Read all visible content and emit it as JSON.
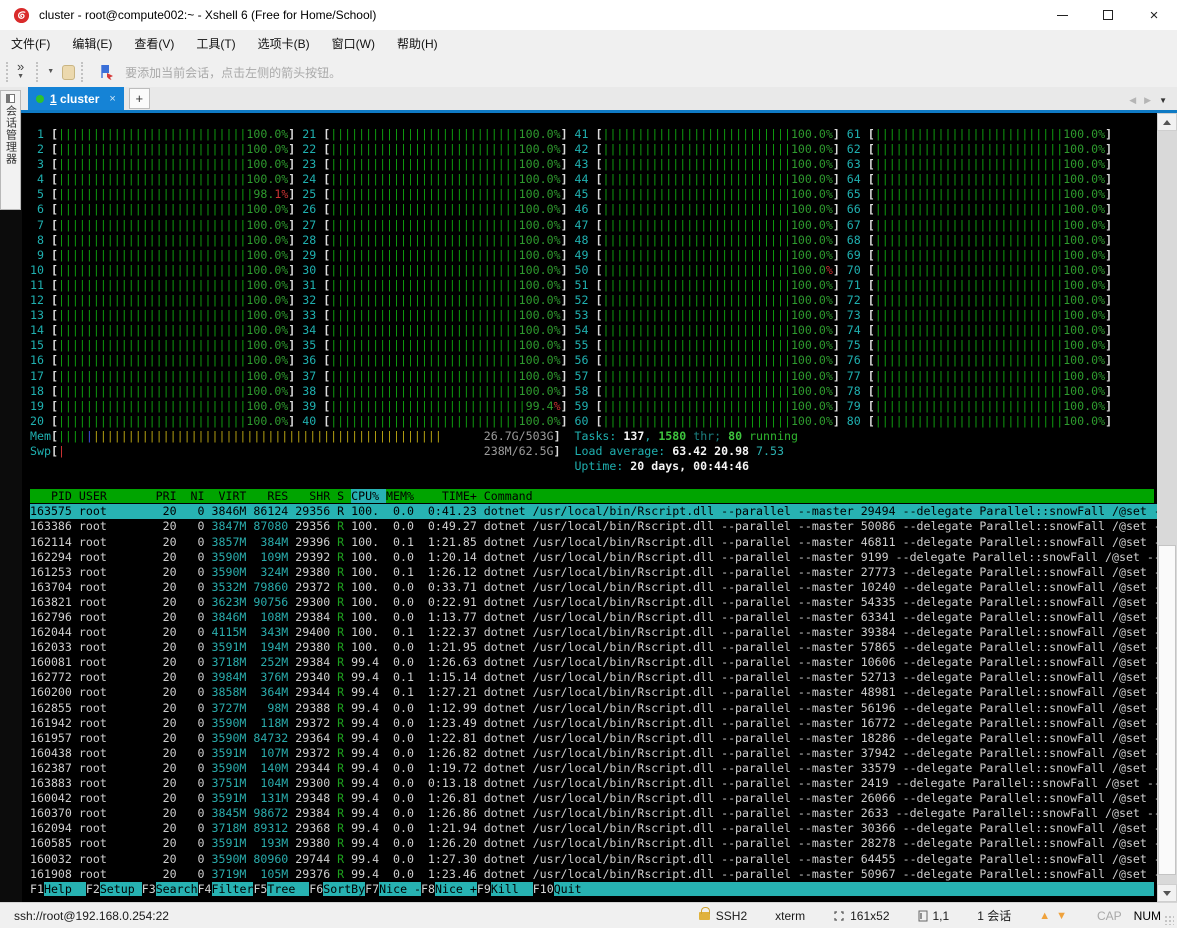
{
  "window": {
    "title": "cluster - root@compute002:~ - Xshell 6 (Free for Home/School)"
  },
  "menu": [
    "文件(F)",
    "编辑(E)",
    "查看(V)",
    "工具(T)",
    "选项卡(B)",
    "窗口(W)",
    "帮助(H)"
  ],
  "toolbar": {
    "chevron": "»",
    "hint": "要添加当前会话，点击左侧的箭头按钮。"
  },
  "side_tab": "会话管理器",
  "tabbar": {
    "tab_number": "1",
    "tab_name": "cluster",
    "close": "×",
    "new_tab": "+"
  },
  "colors": {
    "accent_blue": "#1583d6",
    "tab_underline": "#0f7ac4",
    "term_green": "#00a400",
    "term_cyan": "#27b2b2",
    "term_red": "#cc3333",
    "term_yellow": "#b3a011",
    "status_dot": "#2ec22e"
  },
  "terminal": {
    "cpu": {
      "count": 80,
      "default": [
        "100.0%",
        ""
      ],
      "overrides": {
        "5": [
          "98.",
          "1%"
        ],
        "39": [
          "99.4",
          "%"
        ],
        "50": [
          "100.0",
          "%"
        ]
      }
    },
    "mem": {
      "label": "Mem",
      "value": "26.7G/503G",
      "green": 4,
      "blue": 1,
      "yellow": 50
    },
    "swp": {
      "label": "Swp",
      "value": "238M/62.5G",
      "red": 1
    },
    "tasks": {
      "label": "Tasks: ",
      "count": "137",
      "threads": "1580",
      "thr_word": "thr",
      "running": "80",
      "running_word": "running"
    },
    "load": {
      "label": "Load average: ",
      "values": [
        "63.42",
        "20.98",
        "7.53"
      ]
    },
    "uptime": {
      "label": "Uptime: ",
      "value": "20 days, 00:44:46"
    },
    "header": [
      "PID",
      "USER",
      "PRI",
      "NI",
      "VIRT",
      "RES",
      "SHR",
      "S",
      "CPU%",
      "MEM%",
      "TIME+",
      "Command"
    ],
    "sort_column": "CPU%",
    "selected_pid": "163575",
    "rows": [
      [
        "163575",
        "root",
        "20",
        "0",
        "3846M",
        "86124",
        "29356",
        "R",
        "100.",
        "0.0",
        "0:41.23",
        "dotnet /usr/local/bin/Rscript.dll --parallel --master 29494 --delegate Parallel::snowFall /@set -"
      ],
      [
        "163386",
        "root",
        "20",
        "0",
        "3847M",
        "87080",
        "29356",
        "R",
        "100.",
        "0.0",
        "0:49.27",
        "dotnet /usr/local/bin/Rscript.dll --parallel --master 50086 --delegate Parallel::snowFall /@set -"
      ],
      [
        "162114",
        "root",
        "20",
        "0",
        "3857M",
        "384M",
        "29396",
        "R",
        "100.",
        "0.1",
        "1:21.85",
        "dotnet /usr/local/bin/Rscript.dll --parallel --master 46811 --delegate Parallel::snowFall /@set -"
      ],
      [
        "162294",
        "root",
        "20",
        "0",
        "3590M",
        "109M",
        "29392",
        "R",
        "100.",
        "0.0",
        "1:20.14",
        "dotnet /usr/local/bin/Rscript.dll --parallel --master 9199 --delegate Parallel::snowFall /@set --"
      ],
      [
        "161253",
        "root",
        "20",
        "0",
        "3590M",
        "324M",
        "29380",
        "R",
        "100.",
        "0.1",
        "1:26.12",
        "dotnet /usr/local/bin/Rscript.dll --parallel --master 27773 --delegate Parallel::snowFall /@set -"
      ],
      [
        "163704",
        "root",
        "20",
        "0",
        "3532M",
        "79860",
        "29372",
        "R",
        "100.",
        "0.0",
        "0:33.71",
        "dotnet /usr/local/bin/Rscript.dll --parallel --master 10240 --delegate Parallel::snowFall /@set -"
      ],
      [
        "163821",
        "root",
        "20",
        "0",
        "3623M",
        "90756",
        "29300",
        "R",
        "100.",
        "0.0",
        "0:22.91",
        "dotnet /usr/local/bin/Rscript.dll --parallel --master 54335 --delegate Parallel::snowFall /@set -"
      ],
      [
        "162796",
        "root",
        "20",
        "0",
        "3846M",
        "108M",
        "29384",
        "R",
        "100.",
        "0.0",
        "1:13.77",
        "dotnet /usr/local/bin/Rscript.dll --parallel --master 63341 --delegate Parallel::snowFall /@set -"
      ],
      [
        "162044",
        "root",
        "20",
        "0",
        "4115M",
        "343M",
        "29400",
        "R",
        "100.",
        "0.1",
        "1:22.37",
        "dotnet /usr/local/bin/Rscript.dll --parallel --master 39384 --delegate Parallel::snowFall /@set -"
      ],
      [
        "162033",
        "root",
        "20",
        "0",
        "3591M",
        "194M",
        "29380",
        "R",
        "100.",
        "0.0",
        "1:21.95",
        "dotnet /usr/local/bin/Rscript.dll --parallel --master 57865 --delegate Parallel::snowFall /@set -"
      ],
      [
        "160081",
        "root",
        "20",
        "0",
        "3718M",
        "252M",
        "29384",
        "R",
        "99.4",
        "0.0",
        "1:26.63",
        "dotnet /usr/local/bin/Rscript.dll --parallel --master 10606 --delegate Parallel::snowFall /@set -"
      ],
      [
        "162772",
        "root",
        "20",
        "0",
        "3984M",
        "376M",
        "29340",
        "R",
        "99.4",
        "0.1",
        "1:15.14",
        "dotnet /usr/local/bin/Rscript.dll --parallel --master 52713 --delegate Parallel::snowFall /@set -"
      ],
      [
        "160200",
        "root",
        "20",
        "0",
        "3858M",
        "364M",
        "29344",
        "R",
        "99.4",
        "0.1",
        "1:27.21",
        "dotnet /usr/local/bin/Rscript.dll --parallel --master 48981 --delegate Parallel::snowFall /@set -"
      ],
      [
        "162855",
        "root",
        "20",
        "0",
        "3727M",
        "98M",
        "29388",
        "R",
        "99.4",
        "0.0",
        "1:12.99",
        "dotnet /usr/local/bin/Rscript.dll --parallel --master 56196 --delegate Parallel::snowFall /@set -"
      ],
      [
        "161942",
        "root",
        "20",
        "0",
        "3590M",
        "118M",
        "29372",
        "R",
        "99.4",
        "0.0",
        "1:23.49",
        "dotnet /usr/local/bin/Rscript.dll --parallel --master 16772 --delegate Parallel::snowFall /@set -"
      ],
      [
        "161957",
        "root",
        "20",
        "0",
        "3590M",
        "84732",
        "29364",
        "R",
        "99.4",
        "0.0",
        "1:22.81",
        "dotnet /usr/local/bin/Rscript.dll --parallel --master 18286 --delegate Parallel::snowFall /@set -"
      ],
      [
        "160438",
        "root",
        "20",
        "0",
        "3591M",
        "107M",
        "29372",
        "R",
        "99.4",
        "0.0",
        "1:26.82",
        "dotnet /usr/local/bin/Rscript.dll --parallel --master 37942 --delegate Parallel::snowFall /@set -"
      ],
      [
        "162387",
        "root",
        "20",
        "0",
        "3590M",
        "140M",
        "29344",
        "R",
        "99.4",
        "0.0",
        "1:19.72",
        "dotnet /usr/local/bin/Rscript.dll --parallel --master 33579 --delegate Parallel::snowFall /@set -"
      ],
      [
        "163883",
        "root",
        "20",
        "0",
        "3751M",
        "104M",
        "29300",
        "R",
        "99.4",
        "0.0",
        "0:13.18",
        "dotnet /usr/local/bin/Rscript.dll --parallel --master 2419 --delegate Parallel::snowFall /@set --"
      ],
      [
        "160042",
        "root",
        "20",
        "0",
        "3591M",
        "131M",
        "29348",
        "R",
        "99.4",
        "0.0",
        "1:26.81",
        "dotnet /usr/local/bin/Rscript.dll --parallel --master 26066 --delegate Parallel::snowFall /@set -"
      ],
      [
        "160370",
        "root",
        "20",
        "0",
        "3845M",
        "98672",
        "29384",
        "R",
        "99.4",
        "0.0",
        "1:26.86",
        "dotnet /usr/local/bin/Rscript.dll --parallel --master 2633 --delegate Parallel::snowFall /@set --"
      ],
      [
        "162094",
        "root",
        "20",
        "0",
        "3718M",
        "89312",
        "29368",
        "R",
        "99.4",
        "0.0",
        "1:21.94",
        "dotnet /usr/local/bin/Rscript.dll --parallel --master 30366 --delegate Parallel::snowFall /@set -"
      ],
      [
        "160585",
        "root",
        "20",
        "0",
        "3591M",
        "193M",
        "29380",
        "R",
        "99.4",
        "0.0",
        "1:26.20",
        "dotnet /usr/local/bin/Rscript.dll --parallel --master 28278 --delegate Parallel::snowFall /@set -"
      ],
      [
        "160032",
        "root",
        "20",
        "0",
        "3590M",
        "80960",
        "29744",
        "R",
        "99.4",
        "0.0",
        "1:27.30",
        "dotnet /usr/local/bin/Rscript.dll --parallel --master 64455 --delegate Parallel::snowFall /@set -"
      ],
      [
        "161908",
        "root",
        "20",
        "0",
        "3719M",
        "105M",
        "29376",
        "R",
        "99.4",
        "0.0",
        "1:23.46",
        "dotnet /usr/local/bin/Rscript.dll --parallel --master 50967 --delegate Parallel::snowFall /@set -"
      ]
    ],
    "fkeys": [
      [
        "F1",
        "Help  "
      ],
      [
        "F2",
        "Setup "
      ],
      [
        "F3",
        "Search"
      ],
      [
        "F4",
        "Filter"
      ],
      [
        "F5",
        "Tree  "
      ],
      [
        "F6",
        "SortBy"
      ],
      [
        "F7",
        "Nice -"
      ],
      [
        "F8",
        "Nice +"
      ],
      [
        "F9",
        "Kill  "
      ],
      [
        "F10",
        "Quit  "
      ]
    ]
  },
  "statusbar": {
    "left": "ssh://root@192.168.0.254:22",
    "protocol": "SSH2",
    "term_type": "xterm",
    "size": "161x52",
    "cursor": "1,1",
    "sessions": "1 会话",
    "cap": "CAP",
    "num": "NUM"
  }
}
